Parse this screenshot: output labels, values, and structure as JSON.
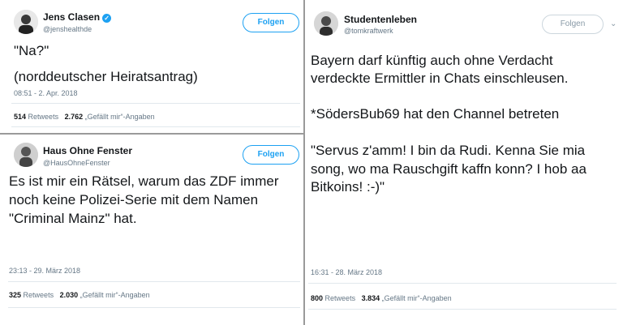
{
  "tweets": [
    {
      "name": "Jens Clasen",
      "verified": "✓",
      "handle": "@jenshealthde",
      "follow": "Folgen",
      "lines": [
        "\"Na?\"",
        "(norddeutscher Heiratsantrag)"
      ],
      "timestamp": "08:51 - 2. Apr. 2018",
      "retweets_count": "514",
      "retweets_label": "Retweets",
      "likes_count": "2.762",
      "likes_label": "„Gefällt mir“-Angaben"
    },
    {
      "name": "Haus Ohne Fenster",
      "handle": "@HausOhneFenster",
      "follow": "Folgen",
      "lines": [
        "Es ist mir ein Rätsel, warum das ZDF immer",
        "noch keine Polizei-Serie mit dem Namen",
        "\"Criminal Mainz\" hat."
      ],
      "timestamp": "23:13 - 29. März 2018",
      "retweets_count": "325",
      "retweets_label": "Retweets",
      "likes_count": "2.030",
      "likes_label": "„Gefällt mir“-Angaben"
    },
    {
      "name": "Studentenleben",
      "handle": "@tomkraftwerk",
      "follow": "Folgen",
      "lines": [
        "Bayern darf künftig auch ohne Verdacht",
        "verdeckte Ermittler in Chats einschleusen.",
        "*SödersBub69 hat den Channel betreten",
        "\"Servus z'amm! I bin da Rudi. Kenna Sie mia",
        "song, wo ma Rauschgift kaffn konn? I hob aa",
        "Bitkoins! :-)\""
      ],
      "timestamp": "16:31 - 28. März 2018",
      "retweets_count": "800",
      "retweets_label": "Retweets",
      "likes_count": "3.834",
      "likes_label": "„Gefällt mir“-Angaben"
    }
  ]
}
